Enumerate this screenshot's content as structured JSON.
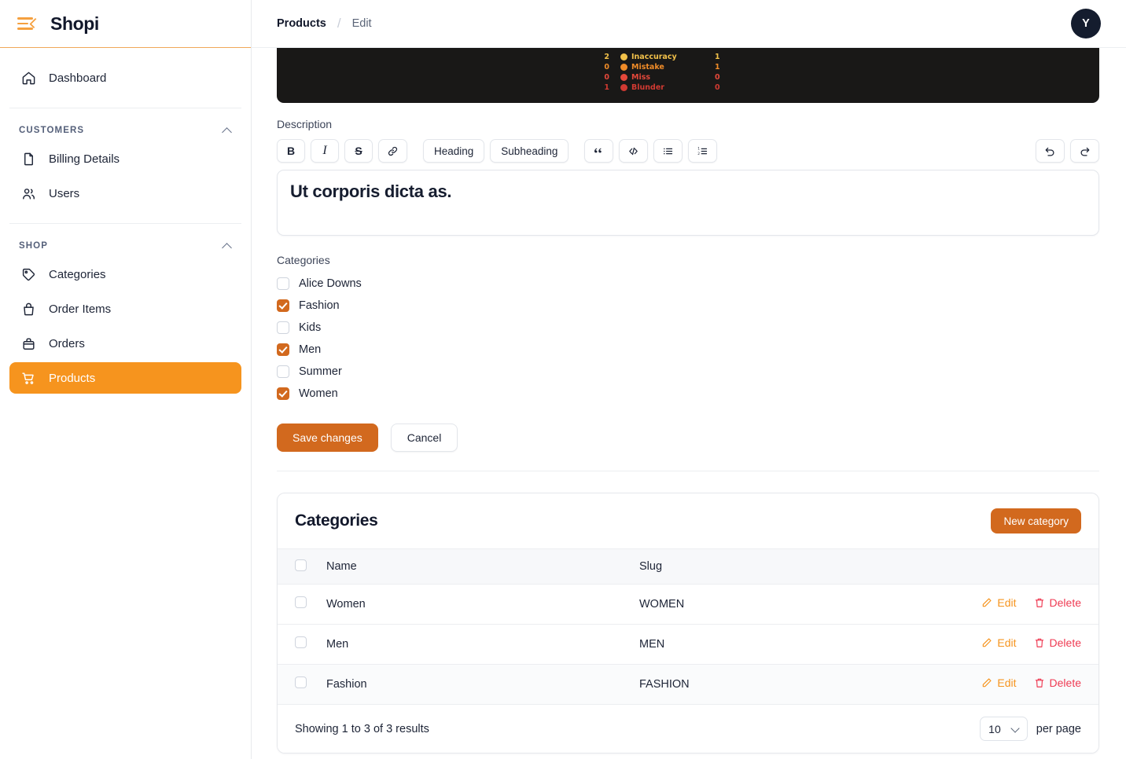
{
  "brand": {
    "title": "Shopi",
    "menu_icon": "hamburger-collapse-icon"
  },
  "sidebar": {
    "dashboard": {
      "label": "Dashboard",
      "icon": "home-icon"
    },
    "groups": [
      {
        "label": "CUSTOMERS",
        "items": [
          {
            "label": "Billing Details",
            "icon": "document-icon"
          },
          {
            "label": "Users",
            "icon": "users-icon"
          }
        ]
      },
      {
        "label": "SHOP",
        "items": [
          {
            "label": "Categories",
            "icon": "tag-icon"
          },
          {
            "label": "Order Items",
            "icon": "bag-handle-icon"
          },
          {
            "label": "Orders",
            "icon": "briefcase-icon"
          },
          {
            "label": "Products",
            "icon": "cart-icon",
            "active": true
          }
        ]
      }
    ]
  },
  "topbar": {
    "breadcrumb": {
      "parent": "Products",
      "separator": "/",
      "current": "Edit"
    },
    "avatar_initial": "Y"
  },
  "banner": {
    "rows": [
      {
        "left": "2",
        "label": "Inaccuracy",
        "right": "1",
        "color": "#f2c14a"
      },
      {
        "left": "0",
        "label": "Mistake",
        "right": "1",
        "color": "#ef8b28"
      },
      {
        "left": "0",
        "label": "Miss",
        "right": "0",
        "color": "#e4483a"
      },
      {
        "left": "1",
        "label": "Blunder",
        "right": "0",
        "color": "#d03a32"
      }
    ]
  },
  "description": {
    "label": "Description",
    "toolbar": {
      "bold": "B",
      "italic": "I",
      "strike": "S",
      "link_icon": "link-icon",
      "heading": "Heading",
      "subheading": "Subheading",
      "quote_icon": "quote-icon",
      "code_icon": "code-icon",
      "bullet_list_icon": "bullet-list-icon",
      "ordered_list_icon": "ordered-list-icon",
      "undo_icon": "undo-icon",
      "redo_icon": "redo-icon"
    },
    "value": "Ut corporis dicta as."
  },
  "categories_field": {
    "label": "Categories",
    "options": [
      {
        "label": "Alice Downs",
        "checked": false
      },
      {
        "label": "Fashion",
        "checked": true
      },
      {
        "label": "Kids",
        "checked": false
      },
      {
        "label": "Men",
        "checked": true
      },
      {
        "label": "Summer",
        "checked": false
      },
      {
        "label": "Women",
        "checked": true
      }
    ]
  },
  "form_actions": {
    "save": "Save changes",
    "cancel": "Cancel"
  },
  "categories_table": {
    "title": "Categories",
    "new_button": "New category",
    "columns": [
      "Name",
      "Slug"
    ],
    "rows": [
      {
        "name": "Women",
        "slug": "WOMEN",
        "edit": "Edit",
        "delete": "Delete"
      },
      {
        "name": "Men",
        "slug": "MEN",
        "edit": "Edit",
        "delete": "Delete"
      },
      {
        "name": "Fashion",
        "slug": "FASHION",
        "edit": "Edit",
        "delete": "Delete"
      }
    ],
    "footer": {
      "showing": "Showing 1 to 3 of 3 results",
      "per_page_value": "10",
      "per_page_label": "per page"
    }
  },
  "colors": {
    "accent": "#F6941E",
    "accent_deep": "#D2691E",
    "danger": "#ef3b53",
    "dark": "#12182b"
  }
}
